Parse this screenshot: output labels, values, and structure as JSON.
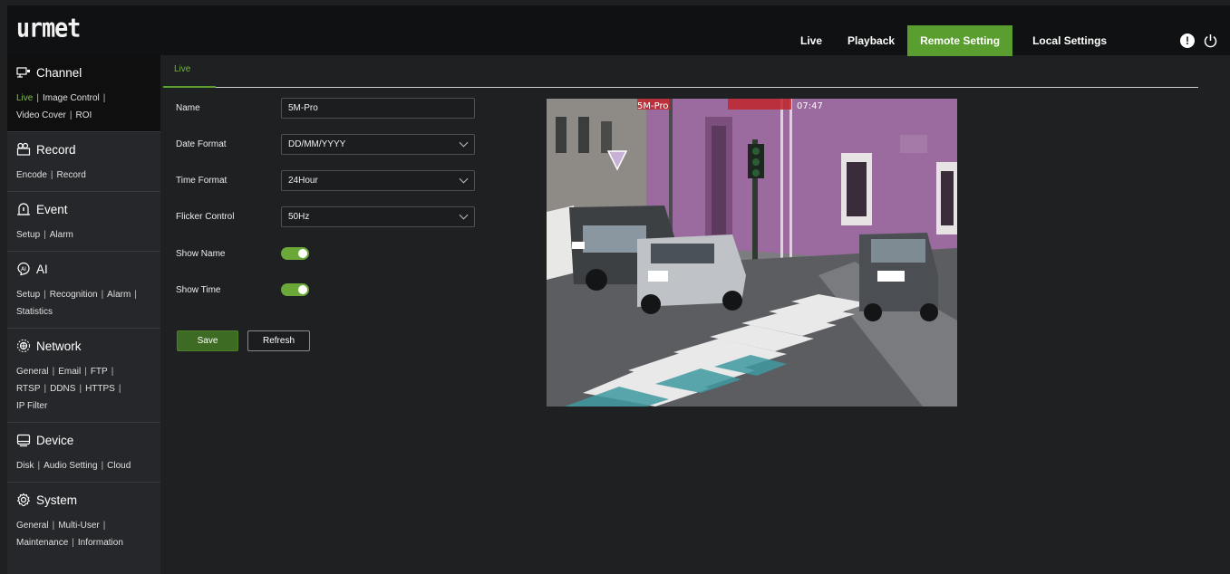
{
  "brand": {
    "logo": "urmet"
  },
  "nav": {
    "items": [
      {
        "label": "Live"
      },
      {
        "label": "Playback"
      },
      {
        "label": "Remote Setting",
        "active": true
      },
      {
        "label": "Local Settings"
      }
    ],
    "alert_icon": "!",
    "active_color": "#5a9e2f"
  },
  "sidebar": {
    "sections": [
      {
        "title": "Channel",
        "icon": "channel-icon",
        "links": [
          "Live",
          "Image Control",
          "Video Cover",
          "ROI"
        ],
        "selected": "Live"
      },
      {
        "title": "Record",
        "icon": "record-icon",
        "links": [
          "Encode",
          "Record"
        ]
      },
      {
        "title": "Event",
        "icon": "event-icon",
        "links": [
          "Setup",
          "Alarm"
        ]
      },
      {
        "title": "AI",
        "icon": "ai-icon",
        "links": [
          "Setup",
          "Recognition",
          "Alarm",
          "Statistics"
        ]
      },
      {
        "title": "Network",
        "icon": "network-icon",
        "links": [
          "General",
          "Email",
          "FTP",
          "RTSP",
          "DDNS",
          "HTTPS",
          "IP Filter"
        ]
      },
      {
        "title": "Device",
        "icon": "device-icon",
        "links": [
          "Disk",
          "Audio Setting",
          "Cloud"
        ]
      },
      {
        "title": "System",
        "icon": "gear-icon",
        "links": [
          "General",
          "Multi-User",
          "Maintenance",
          "Information"
        ]
      }
    ]
  },
  "main": {
    "tab_label": "Live",
    "form": {
      "name_label": "Name",
      "name_value": "5M-Pro",
      "date_format_label": "Date Format",
      "date_format_value": "DD/MM/YYYY",
      "time_format_label": "Time Format",
      "time_format_value": "24Hour",
      "flicker_label": "Flicker Control",
      "flicker_value": "50Hz",
      "show_name_label": "Show Name",
      "show_name_on": true,
      "show_time_label": "Show Time",
      "show_time_on": true
    },
    "save_label": "Save",
    "refresh_label": "Refresh",
    "preview": {
      "osd_name": "5M-Pro",
      "osd_time": "07:47"
    }
  }
}
